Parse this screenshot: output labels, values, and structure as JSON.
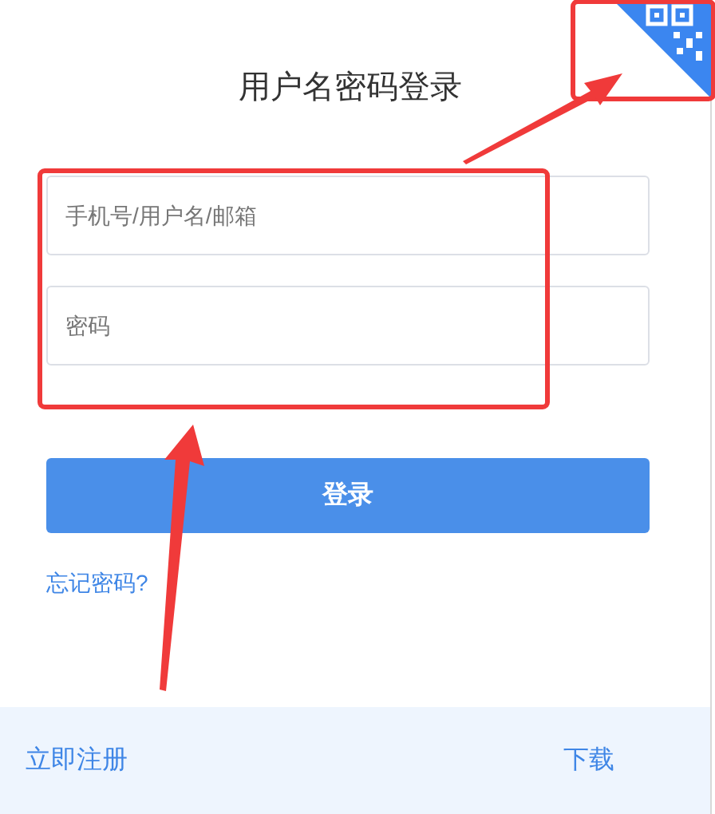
{
  "title": "用户名密码登录",
  "fields": [
    {
      "placeholder": "手机号/用户名/邮箱"
    },
    {
      "placeholder": "密码"
    }
  ],
  "login_button": "登录",
  "forgot_link": "忘记密码?",
  "footer": {
    "register_link": "立即注册",
    "download_link": "下载"
  }
}
